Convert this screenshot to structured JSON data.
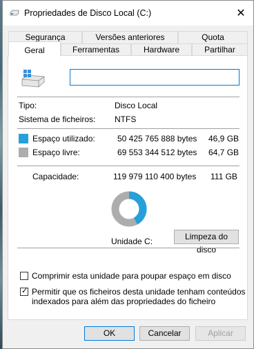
{
  "window": {
    "title": "Propriedades de Disco Local (C:)",
    "close_glyph": "✕"
  },
  "tabs_back": [
    "Segurança",
    "Versões anteriores",
    "Quota"
  ],
  "tabs_front": [
    "Geral",
    "Ferramentas",
    "Hardware",
    "Partilhar"
  ],
  "active_tab": "Geral",
  "name_field": {
    "value": ""
  },
  "info": {
    "type_label": "Tipo:",
    "type_value": "Disco Local",
    "fs_label": "Sistema de ficheiros:",
    "fs_value": "NTFS"
  },
  "usage": {
    "used_label": "Espaço utilizado:",
    "used_bytes": "50 425 765 888 bytes",
    "used_gb": "46,9 GB",
    "free_label": "Espaço livre:",
    "free_bytes": "69 553 344 512 bytes",
    "free_gb": "64,7 GB",
    "capacity_label": "Capacidade:",
    "capacity_bytes": "119 979 110 400 bytes",
    "capacity_gb": "111 GB",
    "used_fraction": 0.42,
    "used_color": "#26a0da",
    "free_color": "#adadad"
  },
  "drive_label": "Unidade C:",
  "cleanup_button": "Limpeza do disco",
  "options": {
    "compress_label": "Comprimir esta unidade para poupar espaço em disco",
    "compress_checked": false,
    "index_label_line1": "Permitir que os ficheiros desta unidade tenham conteúdos",
    "index_label_line2": "indexados para além das propriedades do ficheiro",
    "index_checked": true,
    "check_glyph": "✓"
  },
  "buttons": {
    "ok": "OK",
    "cancel": "Cancelar",
    "apply": "Aplicar"
  },
  "icons": {
    "title": "drive-icon",
    "drive": "drive-windows-icon",
    "close": "close-icon"
  }
}
